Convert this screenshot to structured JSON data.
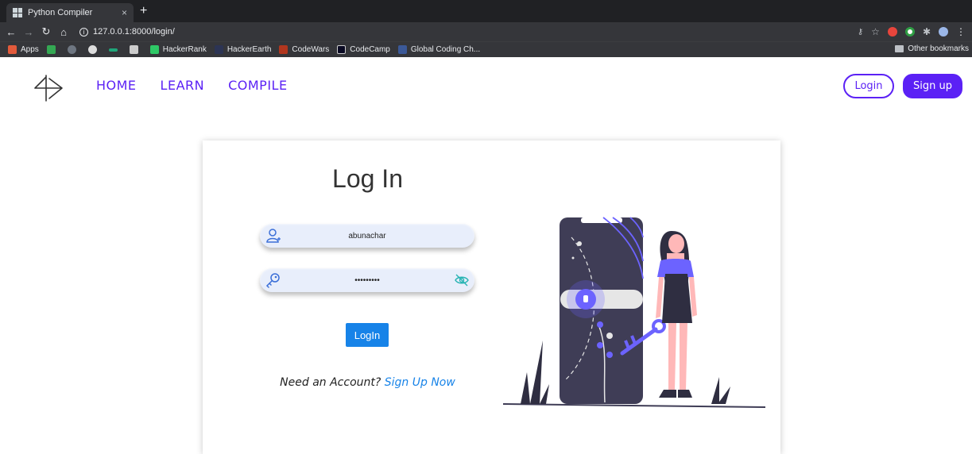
{
  "browser": {
    "tab_title": "Python Compiler",
    "tab_close": "×",
    "new_tab": "+",
    "url": "127.0.0.1:8000/login/",
    "bookmarks": [
      {
        "label": "Apps",
        "color": "#e25a3b"
      },
      {
        "label": "",
        "color": "#34a853"
      },
      {
        "label": "",
        "color": "#6e7681"
      },
      {
        "label": "",
        "color": "#dddddd"
      },
      {
        "label": "",
        "color": "#1fa67a"
      },
      {
        "label": "",
        "color": "#cccccc"
      },
      {
        "label": "HackerRank",
        "color": "#2ec866"
      },
      {
        "label": "HackerEarth",
        "color": "#2c3454"
      },
      {
        "label": "CodeWars",
        "color": "#b1361e"
      },
      {
        "label": "CodeCamp",
        "color": "#0a0a23"
      },
      {
        "label": "Global Coding Ch...",
        "color": "#3b5998"
      }
    ],
    "other_bookmarks": "Other bookmarks"
  },
  "nav": {
    "links": [
      "HOME",
      "LEARN",
      "COMPILE"
    ],
    "login": "Login",
    "signup": "Sign up"
  },
  "login": {
    "title": "Log In",
    "username_value": "abunachar",
    "password_value": "•••••••••",
    "submit": "LogIn",
    "prompt": "Need an Account?",
    "signup_link": "Sign Up Now"
  },
  "colors": {
    "brand": "#5b21f5",
    "link_blue": "#1783e8",
    "field_bg": "#e8eefb"
  },
  "icons": [
    "user-icon",
    "key-icon",
    "eye-off-icon",
    "logo-icon",
    "illustration"
  ]
}
